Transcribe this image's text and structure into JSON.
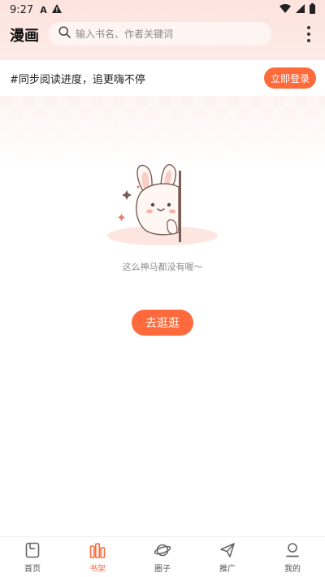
{
  "status_bar": {
    "time": "9:27",
    "icons": [
      "a-icon",
      "warning-icon",
      "wifi-icon",
      "signal-icon",
      "battery-icon"
    ]
  },
  "header": {
    "title": "漫画",
    "search_placeholder": "输入书名、作者关键词"
  },
  "banner": {
    "text": "#同步阅读进度，追更嗨不停",
    "login_label": "立即登录"
  },
  "empty_state": {
    "message": "这么神马都没有喔～",
    "browse_label": "去逛逛"
  },
  "bottom_nav": {
    "items": [
      {
        "label": "首页",
        "icon": "home-icon",
        "active": false
      },
      {
        "label": "书架",
        "icon": "bookshelf-icon",
        "active": true
      },
      {
        "label": "圈子",
        "icon": "planet-icon",
        "active": false
      },
      {
        "label": "推广",
        "icon": "paper-plane-icon",
        "active": false
      },
      {
        "label": "我的",
        "icon": "profile-icon",
        "active": false
      }
    ]
  },
  "colors": {
    "accent": "#ff6a3c",
    "header_bg": "#fde3de",
    "muted_text": "#8c8c8c"
  }
}
